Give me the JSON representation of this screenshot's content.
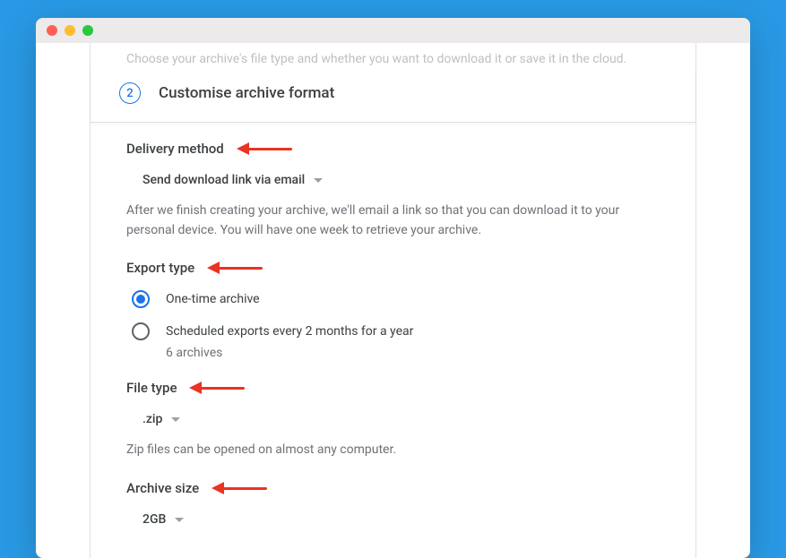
{
  "faded_top_text": "Choose your archive's file type and whether you want to download it or save it in the cloud.",
  "step": {
    "number": "2",
    "title": "Customise archive format"
  },
  "delivery": {
    "label": "Delivery method",
    "selected": "Send download link via email",
    "description": "After we finish creating your archive, we'll email a link so that you can download it to your personal device. You will have one week to retrieve your archive."
  },
  "export_type": {
    "label": "Export type",
    "option_one": "One-time archive",
    "option_scheduled": "Scheduled exports every 2 months for a year",
    "scheduled_sub": "6 archives"
  },
  "file_type": {
    "label": "File type",
    "selected": ".zip",
    "description": "Zip files can be opened on almost any computer."
  },
  "archive_size": {
    "label": "Archive size",
    "selected": "2GB"
  }
}
